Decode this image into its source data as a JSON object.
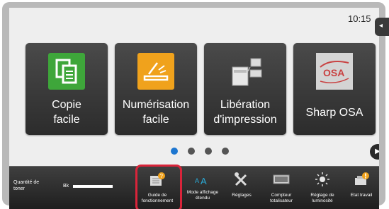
{
  "status": {
    "time": "10:15",
    "side_tab_glyph": "◂"
  },
  "tiles": [
    {
      "label_lines": [
        "Copie",
        "facile"
      ],
      "icon": "copy-icon",
      "color": "#3ea63a"
    },
    {
      "label_lines": [
        "Numérisation",
        "facile"
      ],
      "icon": "scan-icon",
      "color": "#f0a21c"
    },
    {
      "label_lines": [
        "Libération",
        "d'impression"
      ],
      "icon": "print-release-icon",
      "color": "#d5d5d5"
    },
    {
      "label_lines": [
        "Sharp OSA"
      ],
      "icon": "sharp-osa-icon",
      "color": "#d0d0d0"
    }
  ],
  "pager": {
    "pages": 4,
    "active_index": 0,
    "next_glyph": "▶"
  },
  "taskbar": {
    "toner_label": "Quantité de toner",
    "toner_color": "Bk",
    "buttons": [
      {
        "label": "Guide de fonctionnement",
        "icon": "operation-guide-icon"
      },
      {
        "label": "Mode affichage étendu",
        "icon": "enlarge-display-icon"
      },
      {
        "label": "Réglages",
        "icon": "settings-icon"
      },
      {
        "label": "Compteur totalisateur",
        "icon": "total-count-icon"
      },
      {
        "label": "Réglage de luminosité",
        "icon": "brightness-icon"
      },
      {
        "label": "Etat travail",
        "icon": "job-status-icon"
      }
    ]
  },
  "colors": {
    "highlight": "#d9243a",
    "active_dot": "#1d76d0"
  }
}
